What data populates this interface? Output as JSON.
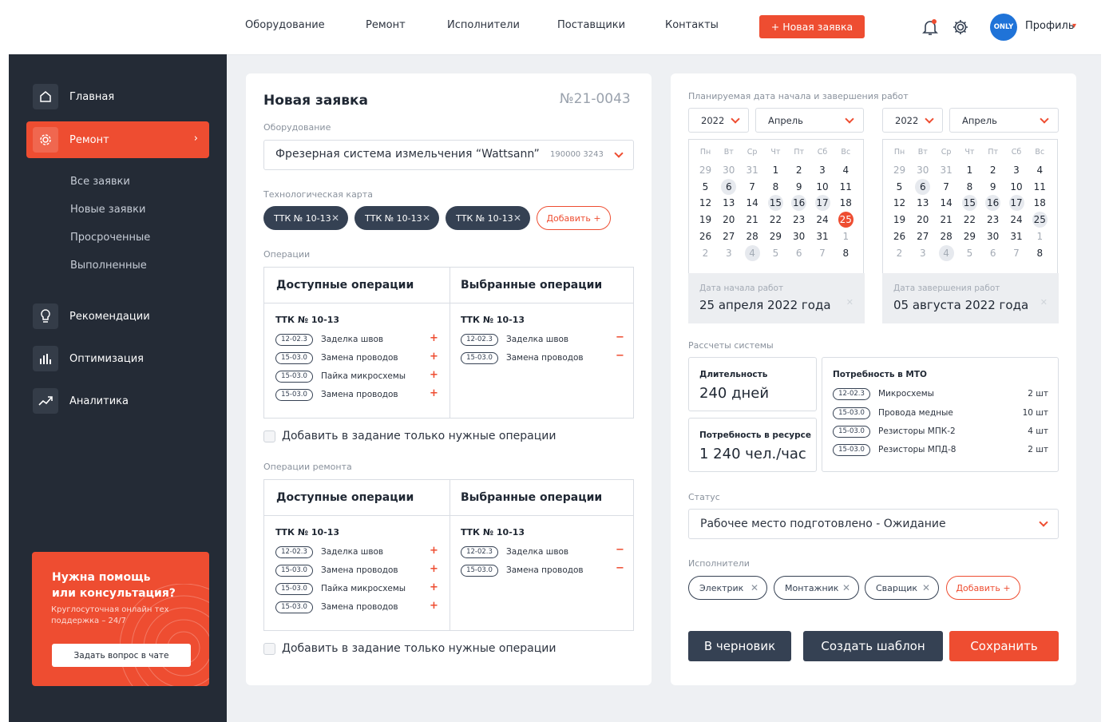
{
  "nav": {
    "items": [
      "Оборудование",
      "Ремонт",
      "Исполнители",
      "Поставщики",
      "Контакты"
    ],
    "new_request": "+ Новая заявка",
    "avatar": "ONLY",
    "profile": "Профиль"
  },
  "sidebar": {
    "items": [
      {
        "label": "Главная",
        "icon": "home-icon"
      },
      {
        "label": "Ремонт",
        "icon": "gear-icon"
      },
      {
        "label": "Рекомендации",
        "icon": "lightbulb-icon"
      },
      {
        "label": "Оптимизация",
        "icon": "bar-chart-icon"
      },
      {
        "label": "Аналитика",
        "icon": "trend-icon"
      }
    ],
    "sub_items": [
      "Все заявки",
      "Новые заявки",
      "Просроченные",
      "Выполненные"
    ],
    "help": {
      "title_line1": "Нужна помощь",
      "title_line2": "или консультация?",
      "text": "Круглосуточная онлайн тех поддержка – 24/7",
      "button": "Задать вопрос в чате"
    }
  },
  "form": {
    "title": "Новая заявка",
    "number": "№21-0043",
    "equipment_label": "Оборудование",
    "equipment_value": "Фрезерная система измельчения “Wattsann”",
    "equipment_code": "190000 3243",
    "tech_card_label": "Технологическая карта",
    "tech_tags": [
      "ТТК № 10-13",
      "ТТК № 10-13",
      "ТТК № 10-13"
    ],
    "add_label": "Добавить",
    "operations_label": "Операции",
    "repair_operations_label": "Операции ремонта",
    "available_header": "Доступные операции",
    "selected_header": "Выбранные операции",
    "group_name": "ТТК № 10-13",
    "available_ops": [
      {
        "code": "12-02.3",
        "name": "Заделка швов"
      },
      {
        "code": "15-03.0",
        "name": "Замена проводов"
      },
      {
        "code": "15-03.0",
        "name": "Пайка микросхемы"
      },
      {
        "code": "15-03.0",
        "name": "Замена проводов"
      }
    ],
    "selected_ops": [
      {
        "code": "12-02.3",
        "name": "Заделка швов"
      },
      {
        "code": "15-03.0",
        "name": "Замена проводов"
      }
    ],
    "only_needed": "Добавить в задание только нужные операции"
  },
  "schedule": {
    "label": "Планируемая дата начала и завершения работ",
    "year": "2022",
    "month": "Апрель",
    "weekdays": [
      "Пн",
      "Вт",
      "Ср",
      "Чт",
      "Пт",
      "Сб",
      "Вс"
    ],
    "days": [
      "29",
      "30",
      "31",
      "1",
      "2",
      "3",
      "4",
      "5",
      "6",
      "7",
      "8",
      "9",
      "10",
      "11",
      "12",
      "13",
      "14",
      "15",
      "16",
      "17",
      "18",
      "19",
      "20",
      "21",
      "22",
      "23",
      "24",
      "25",
      "26",
      "27",
      "28",
      "29",
      "30",
      "31",
      "1",
      "2",
      "3",
      "4",
      "5",
      "6",
      "7",
      "8"
    ],
    "start_label": "Дата начала работ",
    "start_value": "25 апреля 2022 года",
    "end_label": "Дата завершения работ",
    "end_value": "05 августа 2022 года"
  },
  "calc": {
    "label": "Рассчеты системы",
    "duration_label": "Длительность",
    "duration_value": "240 дней",
    "resource_label": "Потребность в ресурсе",
    "resource_value": "1 240 чел./час",
    "mto_label": "Потребность в МТО",
    "mto_items": [
      {
        "code": "12-02.3",
        "name": "Микросхемы",
        "qty": "2 шт"
      },
      {
        "code": "15-03.0",
        "name": "Провода медные",
        "qty": "10 шт"
      },
      {
        "code": "15-03.0",
        "name": "Резисторы МПК-2",
        "qty": "4 шт"
      },
      {
        "code": "15-03.0",
        "name": "Резисторы МПД-8",
        "qty": "2 шт"
      }
    ]
  },
  "status": {
    "label": "Статус",
    "value": "Рабочее место подготовлено - Ожидание"
  },
  "executors": {
    "label": "Исполнители",
    "tags": [
      "Электрик",
      "Монтажник",
      "Сварщик"
    ],
    "add": "Добавить"
  },
  "actions": {
    "draft": "В черновик",
    "template": "Создать шаблон",
    "save": "Сохранить"
  },
  "colors": {
    "accent": "#ee4d31",
    "dark": "#242b36",
    "tag": "#354153"
  }
}
